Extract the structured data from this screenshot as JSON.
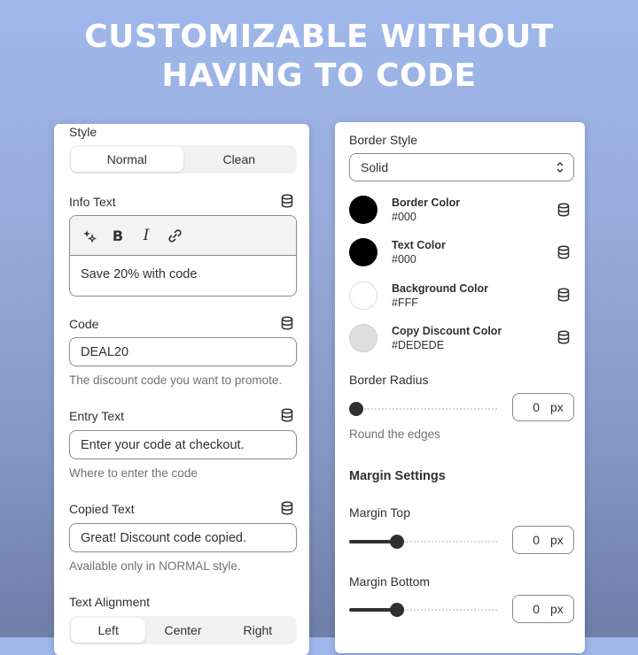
{
  "headline": {
    "line1": "CUSTOMIZABLE WITHOUT",
    "line2": "HAVING TO CODE"
  },
  "left_panel": {
    "style": {
      "label": "Style",
      "options": [
        "Normal",
        "Clean"
      ],
      "selected": "Normal"
    },
    "info_text": {
      "label": "Info Text",
      "value": "Save 20% with code",
      "toolbar_icons": [
        "magic-sparkle-icon",
        "bold-icon",
        "italic-icon",
        "link-icon"
      ]
    },
    "code": {
      "label": "Code",
      "value": "DEAL20",
      "help": "The discount code you want to promote."
    },
    "entry_text": {
      "label": "Entry Text",
      "value": "Enter your code at checkout.",
      "help": "Where to enter the code"
    },
    "copied_text": {
      "label": "Copied Text",
      "value": "Great! Discount code copied.",
      "help": "Available only in NORMAL style."
    },
    "text_alignment": {
      "label": "Text Alignment",
      "options": [
        "Left",
        "Center",
        "Right"
      ],
      "selected": "Left"
    }
  },
  "right_panel": {
    "border_style": {
      "label": "Border Style",
      "value": "Solid"
    },
    "colors": [
      {
        "name": "Border Color",
        "value": "#000",
        "swatch": "#000000"
      },
      {
        "name": "Text Color",
        "value": "#000",
        "swatch": "#000000"
      },
      {
        "name": "Background Color",
        "value": "#FFF",
        "swatch": "#FFFFFF"
      },
      {
        "name": "Copy Discount Color",
        "value": "#DEDEDE",
        "swatch": "#DEDEDE"
      }
    ],
    "border_radius": {
      "label": "Border Radius",
      "value": "0",
      "unit": "px",
      "help": "Round the edges",
      "slider_fraction": 0.0
    },
    "margin_settings": {
      "title": "Margin Settings",
      "margin_top": {
        "label": "Margin Top",
        "value": "0",
        "unit": "px",
        "slider_fraction": 0.32
      },
      "margin_bottom": {
        "label": "Margin Bottom",
        "value": "0",
        "unit": "px",
        "slider_fraction": 0.32
      }
    }
  },
  "colors": {
    "accent_dark": "#303030",
    "background_top": "#9FB7EA",
    "background_bottom": "#6F7EA7"
  }
}
